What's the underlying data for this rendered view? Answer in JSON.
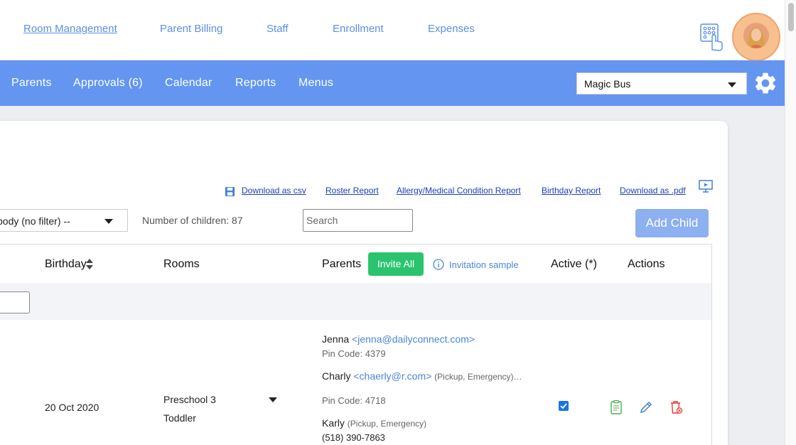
{
  "top_nav": {
    "items": [
      "Room Management",
      "Parent Billing",
      "Staff",
      "Enrollment",
      "Expenses"
    ]
  },
  "blue_nav": {
    "items": [
      "Parents",
      "Approvals (6)",
      "Calendar",
      "Reports",
      "Menus"
    ],
    "site_select": "Magic Bus"
  },
  "report_links": [
    "Download as csv",
    "Roster Report",
    "Allergy/Medical Condition Report",
    "Birthday Report",
    "Download as .pdf"
  ],
  "toolbar": {
    "filter_value": "-- Everybody (no filter) --",
    "children_count": "Number of children: 87",
    "search_placeholder": "Search",
    "add_child_label": "Add Child"
  },
  "table": {
    "headers": {
      "birthday": "Birthday",
      "rooms": "Rooms",
      "parents": "Parents",
      "active": "Active (*)",
      "actions": "Actions"
    },
    "invite_all_label": "Invite All",
    "invitation_sample_label": "Invitation sample",
    "row": {
      "birthday": "20 Oct 2020",
      "rooms": [
        "Preschool 3",
        "Toddler"
      ],
      "active": true,
      "parents": [
        {
          "name": "Jenna",
          "email": "<jenna@dailyconnect.com>",
          "roles": "",
          "pin": "Pin Code: 4379",
          "phone": ""
        },
        {
          "name": "Charly",
          "email": "<chaerly@r.com>",
          "roles": "(Pickup, Emergency)…",
          "pin": "Pin Code: 4718",
          "phone": ""
        },
        {
          "name": "Karly",
          "email": "",
          "roles": "(Pickup, Emergency)",
          "pin": "",
          "phone": "(518) 390-7863"
        }
      ]
    }
  },
  "colors": {
    "nav_blue": "#6496f1",
    "link_blue": "#5b8fe6",
    "invite_green": "#2bc46e",
    "add_child_blue": "#8cb0f0"
  }
}
